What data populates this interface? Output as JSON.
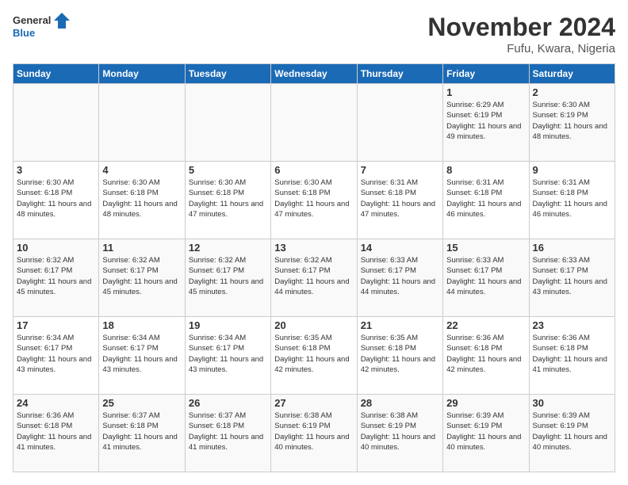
{
  "logo": {
    "line1": "General",
    "line2": "Blue"
  },
  "title": "November 2024",
  "location": "Fufu, Kwara, Nigeria",
  "days_of_week": [
    "Sunday",
    "Monday",
    "Tuesday",
    "Wednesday",
    "Thursday",
    "Friday",
    "Saturday"
  ],
  "weeks": [
    [
      {
        "day": "",
        "info": ""
      },
      {
        "day": "",
        "info": ""
      },
      {
        "day": "",
        "info": ""
      },
      {
        "day": "",
        "info": ""
      },
      {
        "day": "",
        "info": ""
      },
      {
        "day": "1",
        "info": "Sunrise: 6:29 AM\nSunset: 6:19 PM\nDaylight: 11 hours and 49 minutes."
      },
      {
        "day": "2",
        "info": "Sunrise: 6:30 AM\nSunset: 6:19 PM\nDaylight: 11 hours and 48 minutes."
      }
    ],
    [
      {
        "day": "3",
        "info": "Sunrise: 6:30 AM\nSunset: 6:18 PM\nDaylight: 11 hours and 48 minutes."
      },
      {
        "day": "4",
        "info": "Sunrise: 6:30 AM\nSunset: 6:18 PM\nDaylight: 11 hours and 48 minutes."
      },
      {
        "day": "5",
        "info": "Sunrise: 6:30 AM\nSunset: 6:18 PM\nDaylight: 11 hours and 47 minutes."
      },
      {
        "day": "6",
        "info": "Sunrise: 6:30 AM\nSunset: 6:18 PM\nDaylight: 11 hours and 47 minutes."
      },
      {
        "day": "7",
        "info": "Sunrise: 6:31 AM\nSunset: 6:18 PM\nDaylight: 11 hours and 47 minutes."
      },
      {
        "day": "8",
        "info": "Sunrise: 6:31 AM\nSunset: 6:18 PM\nDaylight: 11 hours and 46 minutes."
      },
      {
        "day": "9",
        "info": "Sunrise: 6:31 AM\nSunset: 6:18 PM\nDaylight: 11 hours and 46 minutes."
      }
    ],
    [
      {
        "day": "10",
        "info": "Sunrise: 6:32 AM\nSunset: 6:17 PM\nDaylight: 11 hours and 45 minutes."
      },
      {
        "day": "11",
        "info": "Sunrise: 6:32 AM\nSunset: 6:17 PM\nDaylight: 11 hours and 45 minutes."
      },
      {
        "day": "12",
        "info": "Sunrise: 6:32 AM\nSunset: 6:17 PM\nDaylight: 11 hours and 45 minutes."
      },
      {
        "day": "13",
        "info": "Sunrise: 6:32 AM\nSunset: 6:17 PM\nDaylight: 11 hours and 44 minutes."
      },
      {
        "day": "14",
        "info": "Sunrise: 6:33 AM\nSunset: 6:17 PM\nDaylight: 11 hours and 44 minutes."
      },
      {
        "day": "15",
        "info": "Sunrise: 6:33 AM\nSunset: 6:17 PM\nDaylight: 11 hours and 44 minutes."
      },
      {
        "day": "16",
        "info": "Sunrise: 6:33 AM\nSunset: 6:17 PM\nDaylight: 11 hours and 43 minutes."
      }
    ],
    [
      {
        "day": "17",
        "info": "Sunrise: 6:34 AM\nSunset: 6:17 PM\nDaylight: 11 hours and 43 minutes."
      },
      {
        "day": "18",
        "info": "Sunrise: 6:34 AM\nSunset: 6:17 PM\nDaylight: 11 hours and 43 minutes."
      },
      {
        "day": "19",
        "info": "Sunrise: 6:34 AM\nSunset: 6:17 PM\nDaylight: 11 hours and 43 minutes."
      },
      {
        "day": "20",
        "info": "Sunrise: 6:35 AM\nSunset: 6:18 PM\nDaylight: 11 hours and 42 minutes."
      },
      {
        "day": "21",
        "info": "Sunrise: 6:35 AM\nSunset: 6:18 PM\nDaylight: 11 hours and 42 minutes."
      },
      {
        "day": "22",
        "info": "Sunrise: 6:36 AM\nSunset: 6:18 PM\nDaylight: 11 hours and 42 minutes."
      },
      {
        "day": "23",
        "info": "Sunrise: 6:36 AM\nSunset: 6:18 PM\nDaylight: 11 hours and 41 minutes."
      }
    ],
    [
      {
        "day": "24",
        "info": "Sunrise: 6:36 AM\nSunset: 6:18 PM\nDaylight: 11 hours and 41 minutes."
      },
      {
        "day": "25",
        "info": "Sunrise: 6:37 AM\nSunset: 6:18 PM\nDaylight: 11 hours and 41 minutes."
      },
      {
        "day": "26",
        "info": "Sunrise: 6:37 AM\nSunset: 6:18 PM\nDaylight: 11 hours and 41 minutes."
      },
      {
        "day": "27",
        "info": "Sunrise: 6:38 AM\nSunset: 6:19 PM\nDaylight: 11 hours and 40 minutes."
      },
      {
        "day": "28",
        "info": "Sunrise: 6:38 AM\nSunset: 6:19 PM\nDaylight: 11 hours and 40 minutes."
      },
      {
        "day": "29",
        "info": "Sunrise: 6:39 AM\nSunset: 6:19 PM\nDaylight: 11 hours and 40 minutes."
      },
      {
        "day": "30",
        "info": "Sunrise: 6:39 AM\nSunset: 6:19 PM\nDaylight: 11 hours and 40 minutes."
      }
    ]
  ]
}
